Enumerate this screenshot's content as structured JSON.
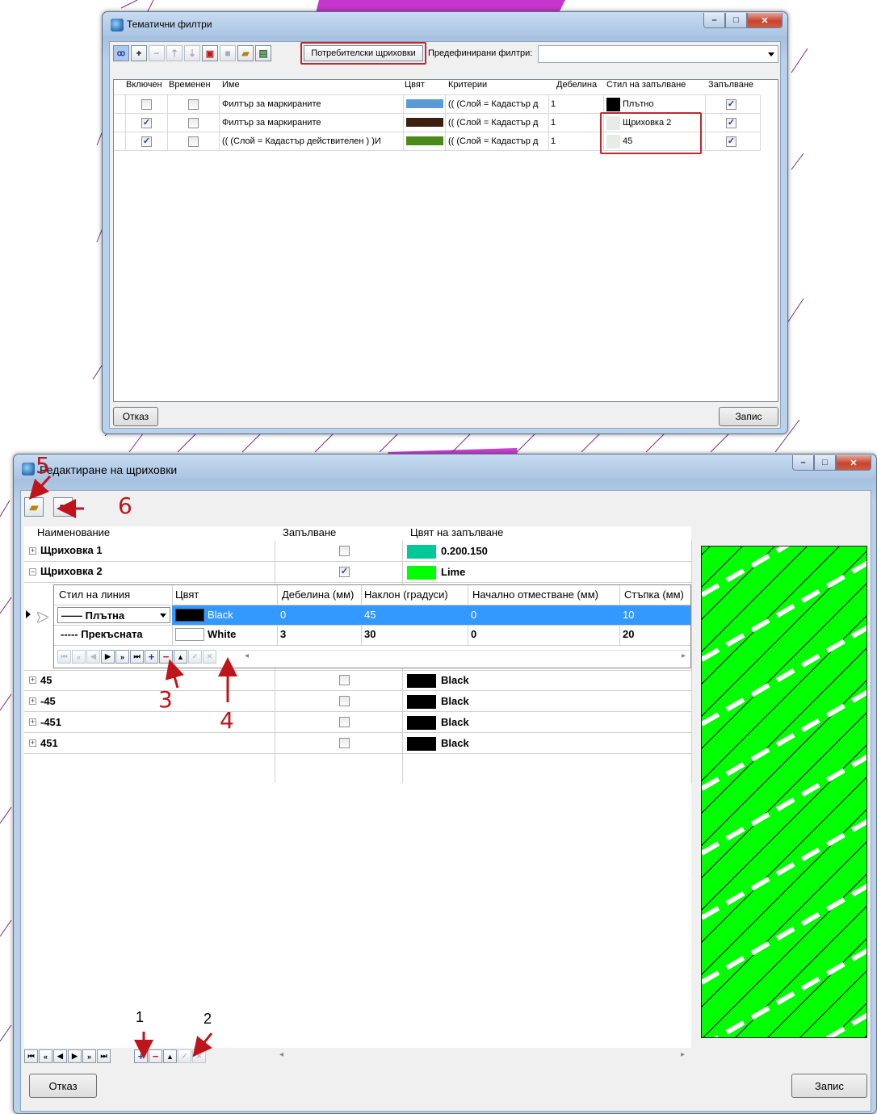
{
  "colors": {
    "magenta": "#c020c8",
    "hatch_green": "#00ff00",
    "selected_row": "#3399ff",
    "annotation_red": "#c0141c",
    "highlight_box": "#c0282d"
  },
  "filters_window": {
    "title": "Тематични филтри",
    "toolbar": {
      "icons": [
        "filter-toggle-icon",
        "plus-icon",
        "minus-icon",
        "arrow-up-icon",
        "arrow-down-icon",
        "pdf-icon",
        "save-icon",
        "open-folder-icon",
        "export-icon"
      ],
      "custom_hatch_button": "Потребителски щриховки",
      "predefined_label": "Предефинирани филтри:",
      "predefined_value": ""
    },
    "columns": [
      "Включен",
      "Временен",
      "Име",
      "Цвят",
      "Критерии",
      "Дебелина",
      "Стил на запълване",
      "Запълване"
    ],
    "rows": [
      {
        "enabled": false,
        "temporary": false,
        "name": "Филтър за маркираните",
        "color": "#5b9bd5",
        "criteria": "(( (Слой = Кадастър д",
        "width": "1",
        "fill_style": "Плътно",
        "fill_swatch": "#000000",
        "fill": true
      },
      {
        "enabled": true,
        "temporary": false,
        "name": "Филтър за маркираните",
        "color": "#3d1f0f",
        "criteria": "(( (Слой = Кадастър д",
        "width": "1",
        "fill_style": "Щриховка 2",
        "fill_swatch": "#e8ece8",
        "fill": true
      },
      {
        "enabled": true,
        "temporary": false,
        "name": "(( (Слой = Кадастър действителен ) )И",
        "color": "#4a8a1a",
        "criteria": "(( (Слой = Кадастър д",
        "width": "1",
        "fill_style": "45",
        "fill_swatch": "#e8ece8",
        "fill": true
      }
    ],
    "cancel_button": "Отказ",
    "save_button": "Запис"
  },
  "hatch_window": {
    "title": "Редактиране на щриховки",
    "toolbar_icons": [
      "open-folder-icon",
      "save-icon"
    ],
    "columns": [
      "Наименование",
      "Запълване",
      "Цвят на запълване"
    ],
    "sub_columns": [
      "Стил на линия",
      "Цвят",
      "Дебелина (мм)",
      "Наклон (градуси)",
      "Начално отместване (мм)",
      "Стъпка (мм)"
    ],
    "hatches": [
      {
        "name": "Щриховка 1",
        "fill": false,
        "fill_color_name": "0.200.150",
        "fill_color": "#00c896",
        "expanded": false
      },
      {
        "name": "Щриховка 2",
        "fill": true,
        "fill_color_name": "Lime",
        "fill_color": "#00ff00",
        "expanded": true
      },
      {
        "name": "45",
        "fill": false,
        "fill_color_name": "Black",
        "fill_color": "#000000",
        "expanded": false
      },
      {
        "name": "-45",
        "fill": false,
        "fill_color_name": "Black",
        "fill_color": "#000000",
        "expanded": false
      },
      {
        "name": "-451",
        "fill": false,
        "fill_color_name": "Black",
        "fill_color": "#000000",
        "expanded": false
      },
      {
        "name": "451",
        "fill": false,
        "fill_color_name": "Black",
        "fill_color": "#000000",
        "expanded": false
      }
    ],
    "lines": [
      {
        "style": "—— Плътна",
        "color_name": "Black",
        "color": "#000000",
        "width": "0",
        "angle": "45",
        "offset": "0",
        "step": "10",
        "selected": true
      },
      {
        "style": "----- Прекъсната",
        "color_name": "White",
        "color": "#ffffff",
        "width": "3",
        "angle": "30",
        "offset": "0",
        "step": "20",
        "selected": false
      }
    ],
    "nav_icons": [
      "first-icon",
      "prev-page-icon",
      "prev-icon",
      "next-icon",
      "next-page-icon",
      "last-icon",
      "add-icon",
      "delete-icon",
      "edit-icon",
      "confirm-icon",
      "cancel-icon"
    ],
    "cancel_button": "Отказ",
    "save_button": "Запис"
  },
  "annotations": {
    "n1": "1",
    "n2": "2",
    "n3": "3",
    "n4": "4",
    "n5": "5",
    "n6": "6"
  }
}
